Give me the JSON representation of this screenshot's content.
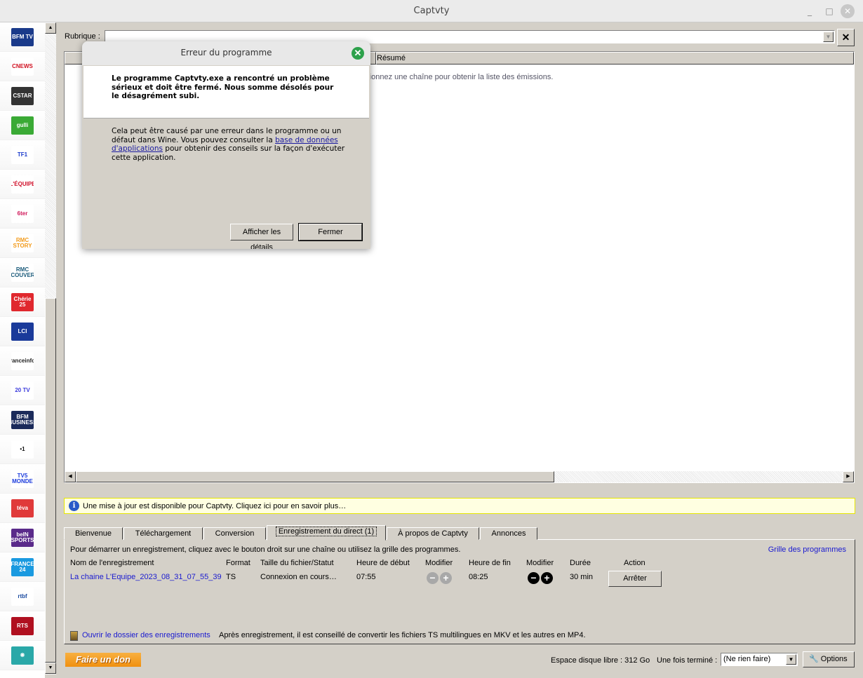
{
  "window": {
    "title": "Captvty",
    "minimize": "_",
    "maximize": "□",
    "close": "✕"
  },
  "channels": [
    {
      "name": "BFM TV",
      "bg": "#1a3a8a",
      "fg": "#fff"
    },
    {
      "name": "CNEWS",
      "bg": "#fff",
      "fg": "#d01020"
    },
    {
      "name": "CSTAR",
      "bg": "#333",
      "fg": "#fff"
    },
    {
      "name": "gulli",
      "bg": "#3aaa35",
      "fg": "#fff"
    },
    {
      "name": "TF1",
      "bg": "#fff",
      "fg": "#1a3acc"
    },
    {
      "name": "L'ÉQUIPE",
      "bg": "#fff",
      "fg": "#d0102a"
    },
    {
      "name": "6ter",
      "bg": "#fff",
      "fg": "#d0185a"
    },
    {
      "name": "RMC STORY",
      "bg": "#fff",
      "fg": "#f29a1a"
    },
    {
      "name": "RMC DÉCOUVERTE",
      "bg": "#fff",
      "fg": "#1a5a7a"
    },
    {
      "name": "Chérie 25",
      "bg": "#e0282e",
      "fg": "#fff"
    },
    {
      "name": "LCI",
      "bg": "#1a3a9a",
      "fg": "#fff"
    },
    {
      "name": "franceinfo:",
      "bg": "#fff",
      "fg": "#222"
    },
    {
      "name": "20 TV",
      "bg": "#fff",
      "fg": "#3a3adc"
    },
    {
      "name": "BFM BUSINESS",
      "bg": "#1a2a5a",
      "fg": "#fff"
    },
    {
      "name": "•1",
      "bg": "#fff",
      "fg": "#111"
    },
    {
      "name": "TV5 MONDE",
      "bg": "#fff",
      "fg": "#1a3adc"
    },
    {
      "name": "téva",
      "bg": "#e03a3a",
      "fg": "#fff"
    },
    {
      "name": "beIN SPORTS",
      "bg": "#5a2a8a",
      "fg": "#fff"
    },
    {
      "name": "FRANCE 24",
      "bg": "#1a9ae0",
      "fg": "#fff"
    },
    {
      "name": "rtbf",
      "bg": "#fff",
      "fg": "#1a4aa0"
    },
    {
      "name": "RTS",
      "bg": "#b01020",
      "fg": "#fff"
    },
    {
      "name": "❋",
      "bg": "#2aa8a8",
      "fg": "#fff"
    }
  ],
  "rubrique": {
    "label": "Rubrique :",
    "value": ""
  },
  "list": {
    "columns": [
      "",
      "",
      "Résumé"
    ],
    "empty_text": "ectionnez une chaîne pour obtenir la liste des émissions."
  },
  "update_bar": {
    "text": "Une mise à jour est disponible pour Captvty. Cliquez ici pour en savoir plus…"
  },
  "tabs": [
    {
      "label": "Bienvenue"
    },
    {
      "label": "Téléchargement"
    },
    {
      "label": "Conversion"
    },
    {
      "label": "Enregistrement du direct (1)",
      "active": true
    },
    {
      "label": "À propos de Captvty"
    },
    {
      "label": "Annonces"
    }
  ],
  "record": {
    "instructions": "Pour démarrer un enregistrement, cliquez avec le bouton droit sur une chaîne ou utilisez la grille des programmes.",
    "grid_link": "Grille des programmes",
    "headers": {
      "name": "Nom de l'enregistrement",
      "format": "Format",
      "size": "Taille du fichier/Statut",
      "start": "Heure de début",
      "modify1": "Modifier",
      "end": "Heure de fin",
      "modify2": "Modifier",
      "duration": "Durée",
      "action": "Action"
    },
    "rows": [
      {
        "name": "La chaine L'Equipe_2023_08_31_07_55_39",
        "format": "TS",
        "status": "Connexion en cours…",
        "start": "07:55",
        "end": "08:25",
        "duration": "30 min",
        "action": "Arrêter"
      }
    ],
    "open_folder": "Ouvrir le dossier des enregistrements",
    "advice": "Après enregistrement, il est conseillé de convertir les fichiers TS multilingues en MKV et les autres en MP4."
  },
  "footer": {
    "donate": "Faire un don",
    "disk": "Espace disque libre : 312 Go",
    "when_done_label": "Une fois terminé :",
    "when_done_value": "(Ne rien faire)",
    "options": "Options"
  },
  "dialog": {
    "title": "Erreur du programme",
    "message": "Le programme Captvty.exe a rencontré un problème sérieux et doit être fermé. Nous somme désolés pour le désagrément subi.",
    "body_before": "Cela peut être causé par une erreur dans le programme ou un défaut dans Wine. Vous pouvez consulter la ",
    "body_link": "base de données d'applications",
    "body_after": " pour obtenir des conseils sur la façon d'exécuter cette application.",
    "details_button": "Afficher les détails",
    "close_button": "Fermer"
  },
  "colors": {
    "accent_link": "#1a1ad0",
    "dialog_close": "#2da14b",
    "donate": "#f5a020",
    "update_bg": "#ffffe1"
  }
}
